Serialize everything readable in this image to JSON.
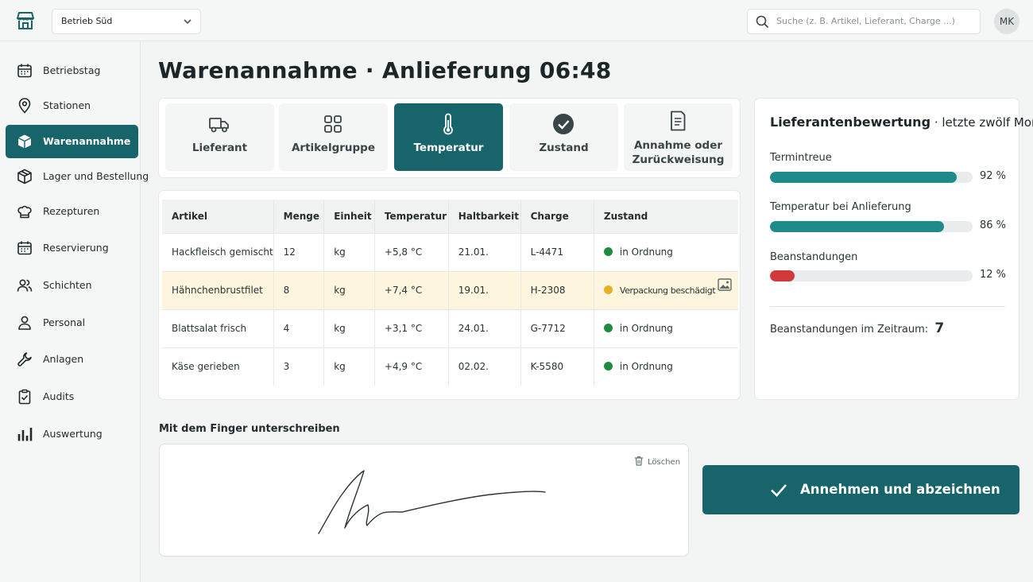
{
  "header": {
    "site": "Betrieb Süd",
    "search_placeholder": "Suche (z. B. Artikel, Lieferant, Charge ...)",
    "avatar_initials": "MK"
  },
  "sidebar": {
    "items": [
      {
        "label": "Betriebstag",
        "icon": "calendar-icon",
        "active": false
      },
      {
        "label": "Stationen",
        "icon": "location-pin-icon",
        "active": false
      },
      {
        "label": "Warenannahme",
        "icon": "box-icon",
        "active": true
      },
      {
        "label": "Lager und Bestellung",
        "icon": "package-icon",
        "active": false
      },
      {
        "label": "Rezepturen",
        "icon": "chef-hat-icon",
        "active": false
      },
      {
        "label": "Reservierung",
        "icon": "calendar-icon",
        "active": false
      },
      {
        "label": "Schichten",
        "icon": "people-icon",
        "active": false
      },
      {
        "label": "Personal",
        "icon": "person-icon",
        "active": false
      },
      {
        "label": "Anlagen",
        "icon": "wrench-icon",
        "active": false
      },
      {
        "label": "Audits",
        "icon": "clipboard-icon",
        "active": false
      },
      {
        "label": "Auswertung",
        "icon": "bar-chart-icon",
        "active": false
      }
    ]
  },
  "page": {
    "title": "Warenannahme · Anlieferung 06:48"
  },
  "steps": [
    {
      "label": "Lieferant",
      "icon": "truck-icon",
      "active": false
    },
    {
      "label": "Artikelgruppe",
      "icon": "grid-icon",
      "active": false
    },
    {
      "label": "Temperatur",
      "icon": "thermometer-icon",
      "active": true
    },
    {
      "label": "Zustand",
      "icon": "check-circle-icon",
      "active": false
    },
    {
      "label": "Annahme oder Zurückweisung",
      "line1": "Annahme oder",
      "line2": "Zurückweisung",
      "icon": "document-icon",
      "active": false
    }
  ],
  "table": {
    "headers": [
      "Artikel",
      "Menge",
      "Einheit",
      "Temperatur",
      "Haltbarkeit",
      "Charge",
      "Zustand"
    ],
    "rows": [
      {
        "artikel": "Hackfleisch gemischt",
        "menge": "12",
        "einheit": "kg",
        "temperatur": "+5,8 °C",
        "haltbarkeit": "21.01.",
        "charge": "L-4471",
        "zustand": "in Ordnung"
      },
      {
        "artikel": "Hähnchenbrustfilet",
        "menge": "8",
        "einheit": "kg",
        "temperatur": "+7,4 °C",
        "haltbarkeit": "19.01.",
        "charge": "H-2308",
        "zustand": "Verpackung beschädigt"
      },
      {
        "artikel": "Blattsalat frisch",
        "menge": "4",
        "einheit": "kg",
        "temperatur": "+3,1 °C",
        "haltbarkeit": "24.01.",
        "charge": "G-7712",
        "zustand": "in Ordnung"
      },
      {
        "artikel": "Käse gerieben",
        "menge": "3",
        "einheit": "kg",
        "temperatur": "+4,9 °C",
        "haltbarkeit": "02.02.",
        "charge": "K-5580",
        "zustand": "in Ordnung"
      }
    ],
    "status_colors": {
      "ok": "#1e8a3c",
      "warn": "#e6b022"
    }
  },
  "rating": {
    "title": "Lieferantenbewertung",
    "subtitle": "· letzte zwölf Monate",
    "metrics": [
      {
        "label": "Termintreue",
        "value": 92,
        "display": "92 %",
        "color": "#1e8a8a"
      },
      {
        "label": "Temperatur bei Anlieferung",
        "value": 86,
        "display": "86 %",
        "color": "#1e8a8a"
      },
      {
        "label": "Beanstandungen",
        "value": 12,
        "display": "12 %",
        "color": "#d03a3a"
      }
    ],
    "complaints_label": "Beanstandungen im Zeitraum:",
    "complaints_count": "7"
  },
  "signature": {
    "label": "Mit dem Finger unterschreiben",
    "clear_label": "Löschen"
  },
  "accept_button": {
    "label": "Annehmen und abzeichnen"
  },
  "colors": {
    "accent": "#17656a"
  }
}
